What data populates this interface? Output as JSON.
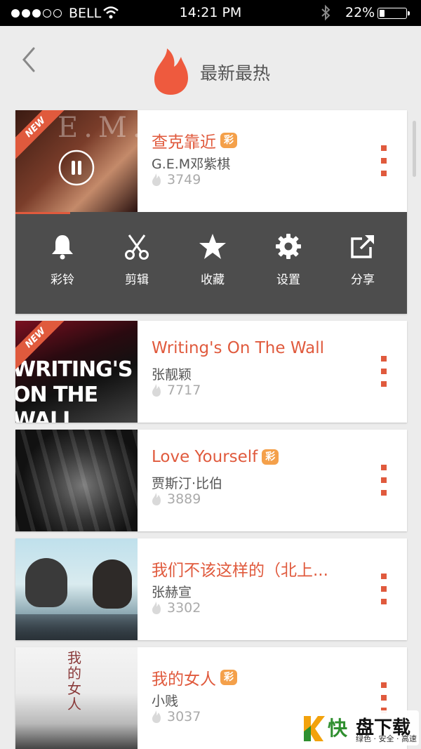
{
  "status_bar": {
    "carrier": "BELL",
    "time": "14:21 PM",
    "battery": "22%",
    "battery_level": 0.22,
    "signal_bars": 3,
    "signal_total": 5
  },
  "header": {
    "title": "最新最热",
    "back_icon": "chevron-left-icon",
    "logo_icon": "flame-icon"
  },
  "songs": [
    {
      "title": "查克靠近",
      "badge": "彩",
      "artist": "G.E.M邓紫棋",
      "plays": "3749",
      "is_new": true,
      "new_label": "NEW",
      "cover_text": "E.M."
    },
    {
      "title": "Writing's On The Wall",
      "badge": "",
      "artist": "张靓颖",
      "plays": "7717",
      "is_new": true,
      "new_label": "NEW",
      "cover_text": "WRITING'S ON THE WALL"
    },
    {
      "title": "Love Yourself",
      "badge": "彩",
      "artist": "贾斯汀·比伯",
      "plays": "3889",
      "is_new": false
    },
    {
      "title": "我们不该这样的（北上...",
      "badge": "",
      "artist": "张赫宣",
      "plays": "3302",
      "is_new": false
    },
    {
      "title": "我的女人",
      "badge": "彩",
      "artist": "小贱",
      "plays": "3037",
      "is_new": false,
      "cover_text": "我的女人"
    }
  ],
  "player": {
    "progress": 0.14,
    "state_icon": "pause-icon"
  },
  "actions": [
    {
      "label": "彩铃",
      "icon": "bell-icon"
    },
    {
      "label": "剪辑",
      "icon": "scissors-icon"
    },
    {
      "label": "收藏",
      "icon": "star-icon"
    },
    {
      "label": "设置",
      "icon": "gear-icon"
    },
    {
      "label": "分享",
      "icon": "share-icon"
    }
  ],
  "watermark": {
    "brand_left": "快",
    "brand_right": "盘下载",
    "tagline": "绿色 · 安全 · 高速"
  },
  "colors": {
    "accent": "#e05a3d",
    "badge": "#f4a04a",
    "action_bar": "#4d4d4d",
    "background": "#ececec"
  }
}
